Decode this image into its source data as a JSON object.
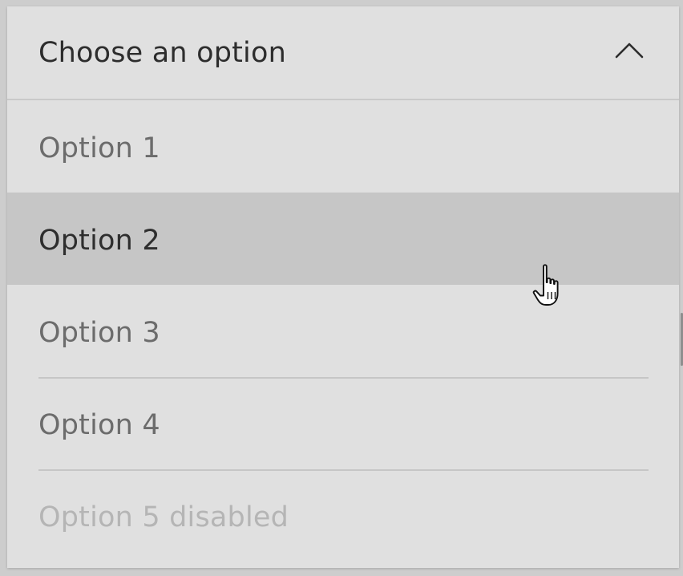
{
  "dropdown": {
    "placeholder": "Choose an option",
    "expanded": true,
    "hovered_option_index": 1,
    "options": [
      {
        "label": "Option 1",
        "disabled": false
      },
      {
        "label": "Option 2",
        "disabled": false
      },
      {
        "label": "Option 3",
        "disabled": false
      },
      {
        "label": "Option 4",
        "disabled": false
      },
      {
        "label": "Option 5 disabled",
        "disabled": true
      }
    ]
  },
  "icons": {
    "trigger": "chevron-up-icon",
    "pointer": "hand-pointer-icon"
  },
  "colors": {
    "surface": "#e0e0e0",
    "hover": "#c6c6c6",
    "divider": "#c6c6c6",
    "text_primary": "#2d2d2d",
    "text_secondary": "#6c6c6c",
    "text_disabled": "#b5b5b5"
  }
}
